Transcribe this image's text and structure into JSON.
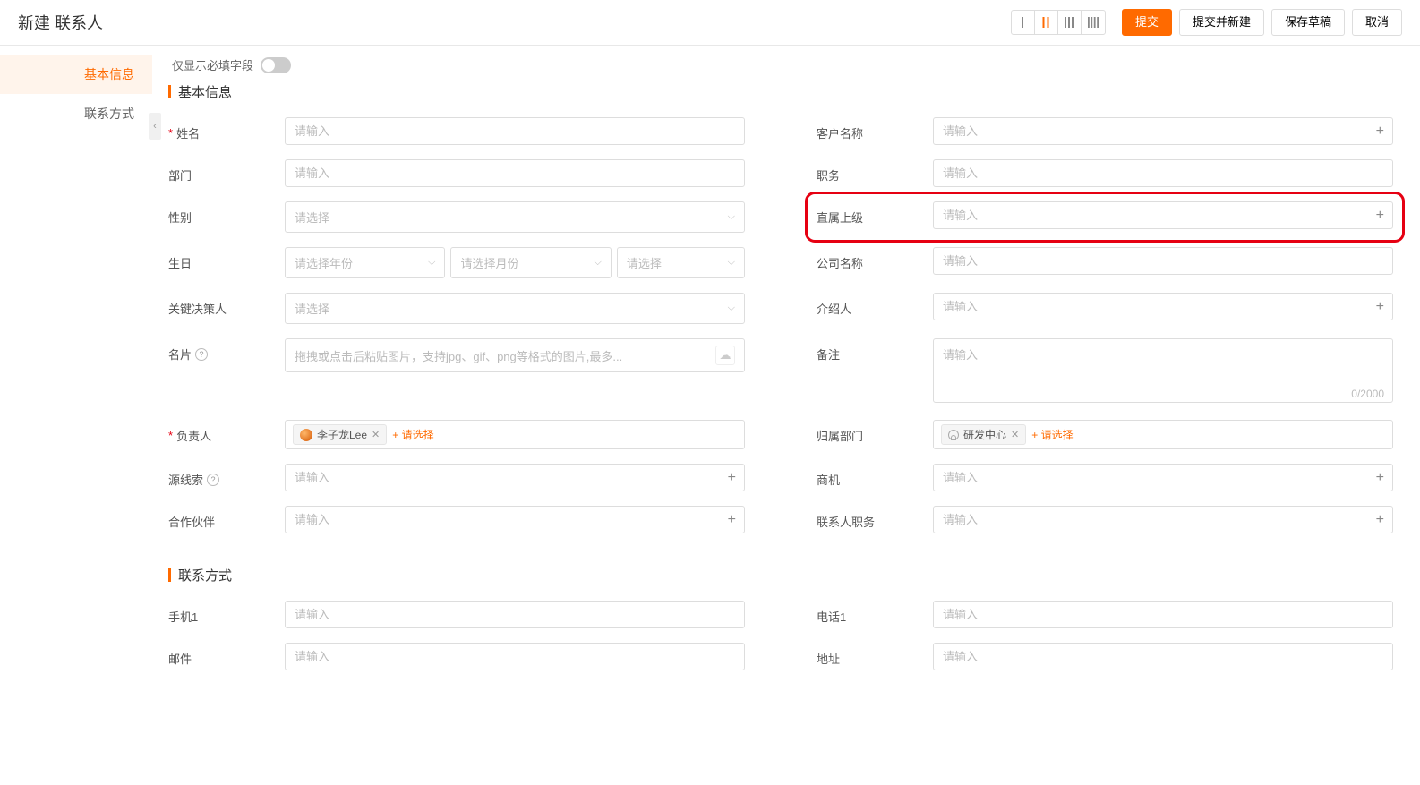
{
  "header": {
    "title": "新建 联系人",
    "submit": "提交",
    "submit_and_new": "提交并新建",
    "save_draft": "保存草稿",
    "cancel": "取消"
  },
  "sidebar": {
    "items": [
      {
        "label": "基本信息"
      },
      {
        "label": "联系方式"
      }
    ]
  },
  "toggle": {
    "label": "仅显示必填字段"
  },
  "sections": {
    "basic": {
      "title": "基本信息"
    },
    "contact": {
      "title": "联系方式"
    }
  },
  "placeholders": {
    "text": "请输入",
    "select": "请选择",
    "select_year": "请选择年份",
    "select_month": "请选择月份",
    "upload": "拖拽或点击后粘贴图片，支持jpg、gif、png等格式的图片,最多...",
    "add_select": "+ 请选择"
  },
  "labels": {
    "name": "姓名",
    "customer_name": "客户名称",
    "department": "部门",
    "position": "职务",
    "gender": "性别",
    "supervisor": "直属上级",
    "birthday": "生日",
    "company_name": "公司名称",
    "key_decision": "关键决策人",
    "introducer": "介绍人",
    "business_card": "名片",
    "remark": "备注",
    "owner": "负责人",
    "owning_dept": "归属部门",
    "source_lead": "源线索",
    "opportunity": "商机",
    "partner": "合作伙伴",
    "contact_position": "联系人职务",
    "mobile1": "手机1",
    "phone1": "电话1",
    "email": "邮件",
    "address": "地址"
  },
  "values": {
    "owner_tag": "李子龙Lee",
    "dept_tag": "研发中心",
    "remark_counter": "0/2000"
  }
}
